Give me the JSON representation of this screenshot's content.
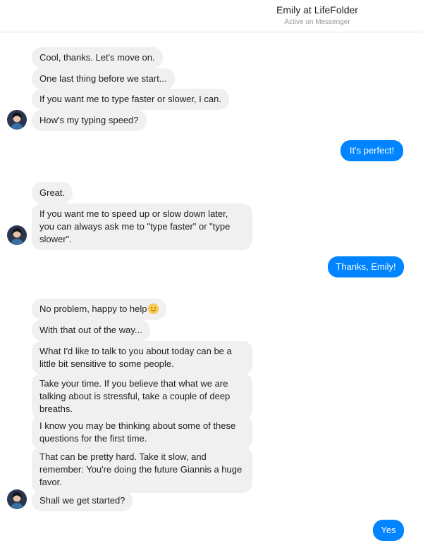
{
  "header": {
    "title": "Emily at LifeFolder",
    "subtitle": "Active on Messenger"
  },
  "messages": {
    "m1": "Cool, thanks. Let's move on.",
    "m2": "One last thing before we start...",
    "m3": "If you want me to type faster or slower, I can.",
    "m4": "How's my typing speed?",
    "r1": "It's perfect!",
    "m5": "Great.",
    "m6": "If you want me to speed up or slow down later, you can always ask me to \"type faster\" or \"type slower\".",
    "r2": "Thanks, Emily!",
    "m7": "No problem, happy to help",
    "m8": "With that out of the way...",
    "m9": "What I'd like to talk to you about today can be a little bit sensitive to some people.",
    "m10": "Take your time. If you believe that what we are talking about is stressful, take a couple of deep breaths.",
    "m11": "I know you may be thinking about some of these questions for the first time.",
    "m12": "That can be pretty hard. Take it slow, and remember: You're doing the future Giannis a huge favor.",
    "m13": "Shall we get started?",
    "r3": "Yes"
  },
  "icons": {
    "smile_emoji": "slightly-smiling-face-icon",
    "avatar": "emily-avatar"
  },
  "colors": {
    "outgoing_bubble": "#0084ff",
    "incoming_bubble": "#f1f0f0"
  }
}
